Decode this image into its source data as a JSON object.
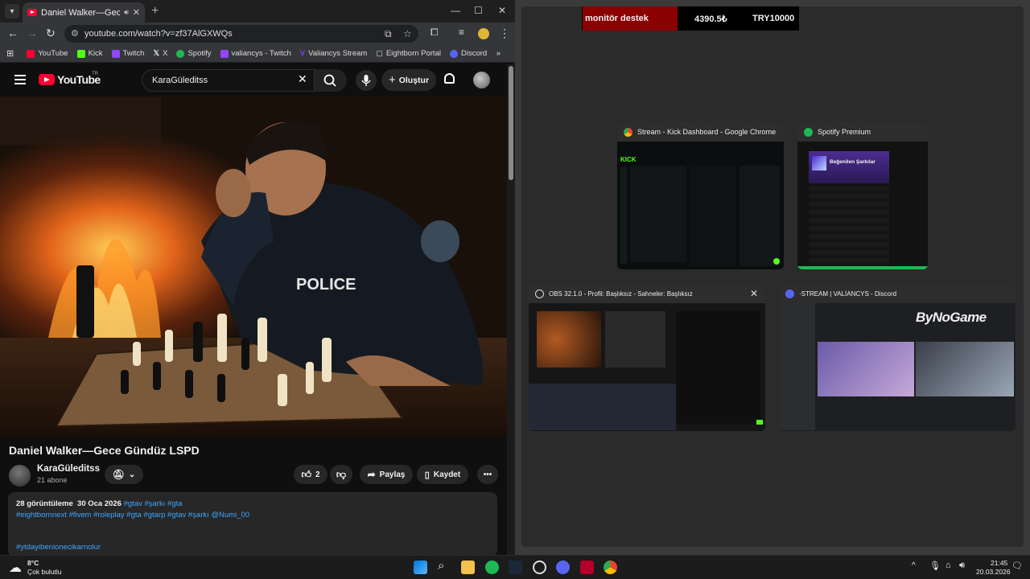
{
  "browser": {
    "tab_title": "Daniel Walker—Gece Gündüz LSPD",
    "url": "youtube.com/watch?v=zf37AlGXWQs",
    "bookmarks": [
      "YouTube",
      "Kick",
      "Twitch",
      "X",
      "Spotify",
      "valiancys - Twitch",
      "Valiancys Stream",
      "Eightborn Portal",
      "Discord"
    ]
  },
  "youtube": {
    "logo_text": "YouTube",
    "logo_region": "TR",
    "search_value": "KaraGüleditss",
    "create_label": "Oluştur",
    "video": {
      "title": "Daniel Walker—Gece Gündüz LSPD",
      "channel": "KaraGüleditss",
      "subscribers": "21 abone",
      "likes": "2",
      "share_label": "Paylaş",
      "save_label": "Kaydet",
      "badge_text": "POLICE"
    },
    "description": {
      "views": "28 görüntüleme",
      "date": "30 Oca 2026",
      "tags_line1": "#gtav #şarkı #gta",
      "tags_line2": "#eightbornnext #fivem #roleplay #gta #gtarp #gtav #şarkı @Numi_00",
      "tags_line3": "#ytdayibenionecikarnolur"
    }
  },
  "ticker": {
    "label": "monitör destek",
    "amount": "4390.5₺",
    "goal": "TRY10000"
  },
  "task_view": [
    {
      "title": "Stream - Kick Dashboard - Google Chrome",
      "icon": "chrome-icon"
    },
    {
      "title": "Spotify Premium",
      "icon": "spotify-icon",
      "inner_title": "Beğenilen Şarkılar"
    },
    {
      "title": "OBS 32.1.0 - Profil: Başlıksız - Sahneler: Başlıksız",
      "icon": "obs-icon"
    },
    {
      "title": "·STREAM | VALİANCYS - Discord",
      "icon": "discord-icon",
      "brand": "ByNoGame"
    }
  ],
  "taskbar": {
    "weather_temp": "8°C",
    "weather_desc": "Çok bulutlu",
    "time": "21:45",
    "date": "20.03.2026"
  },
  "colors": {
    "youtube_red": "#ff0033",
    "link_blue": "#3ea6ff",
    "kick_green": "#53fc18",
    "spotify_green": "#1db954",
    "ticker_red": "#8b0000"
  }
}
